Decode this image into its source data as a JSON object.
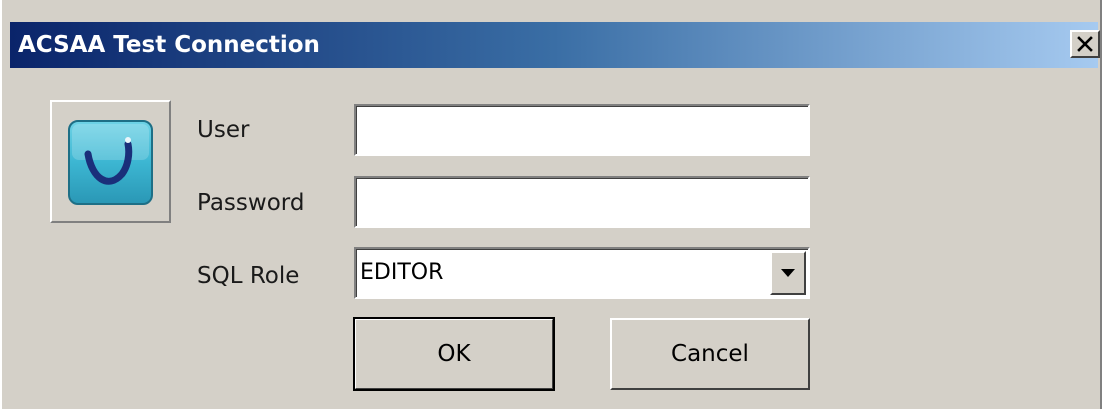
{
  "window": {
    "title": "ACSAA Test Connection"
  },
  "titlebar": {
    "close_icon": "close-icon",
    "gradient_start": "#0a246a",
    "gradient_end": "#a6caf0"
  },
  "logo": {
    "icon": "acsaa-logo-icon",
    "tile_color": "#3cb6d2"
  },
  "form": {
    "user_label": "User",
    "user_value": "",
    "password_label": "Password",
    "password_value": "",
    "sql_role_label": "SQL Role",
    "sql_role_value": "EDITOR"
  },
  "buttons": {
    "ok_label": "OK",
    "cancel_label": "Cancel"
  }
}
